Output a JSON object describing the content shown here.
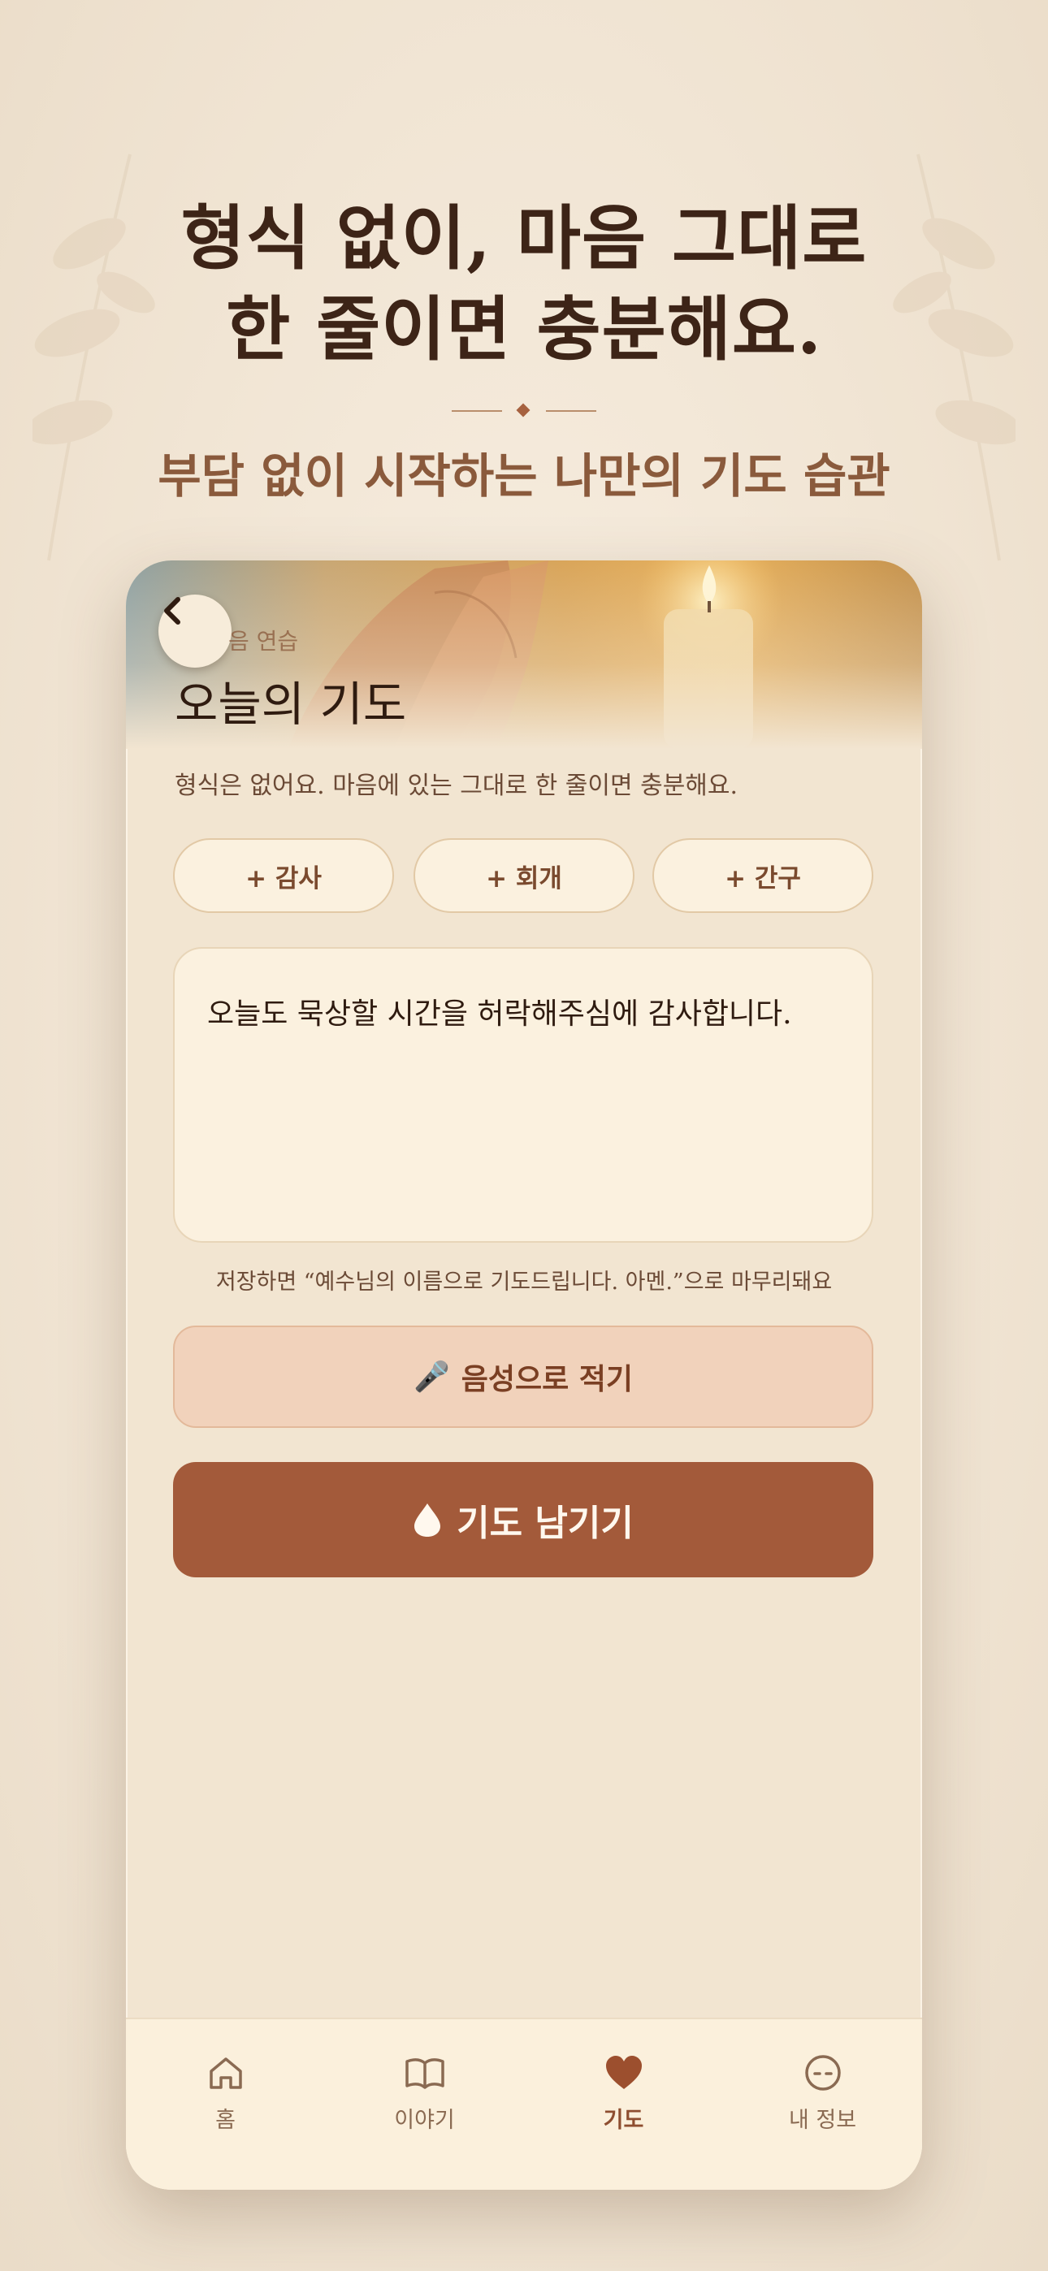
{
  "marketing": {
    "headline_line1": "형식 없이, 마음 그대로",
    "headline_line2": "한 줄이면 충분해요.",
    "subheadline": "부담 없이 시작하는 나만의 기도 습관"
  },
  "screen": {
    "eyebrow": "음 연습",
    "title": "오늘의 기도",
    "intro": "형식은 없어요. 마음에 있는 그대로 한 줄이면 충분해요.",
    "chips": [
      "+ 감사",
      "+ 회개",
      "+ 간구"
    ],
    "prayer_text": "오늘도 묵상할 시간을 허락해주심에 감사합니다.",
    "save_note": "저장하면 “예수님의 이름으로 기도드립니다. 아멘.”으로 마무리돼요",
    "voice_icon": "🎤",
    "voice_label": "음성으로 적기",
    "submit_icon": "drop-icon",
    "submit_label": "기도 남기기"
  },
  "tabbar": {
    "items": [
      {
        "label": "홈",
        "icon": "home-icon",
        "active": false
      },
      {
        "label": "이야기",
        "icon": "book-icon",
        "active": false
      },
      {
        "label": "기도",
        "icon": "heart-icon",
        "active": true
      },
      {
        "label": "내 정보",
        "icon": "profile-icon",
        "active": false
      }
    ]
  },
  "colors": {
    "accent": "#a35a3a",
    "background": "#f2e5d1",
    "voice_button": "#f1d2bb",
    "text_dark": "#3d2417"
  }
}
